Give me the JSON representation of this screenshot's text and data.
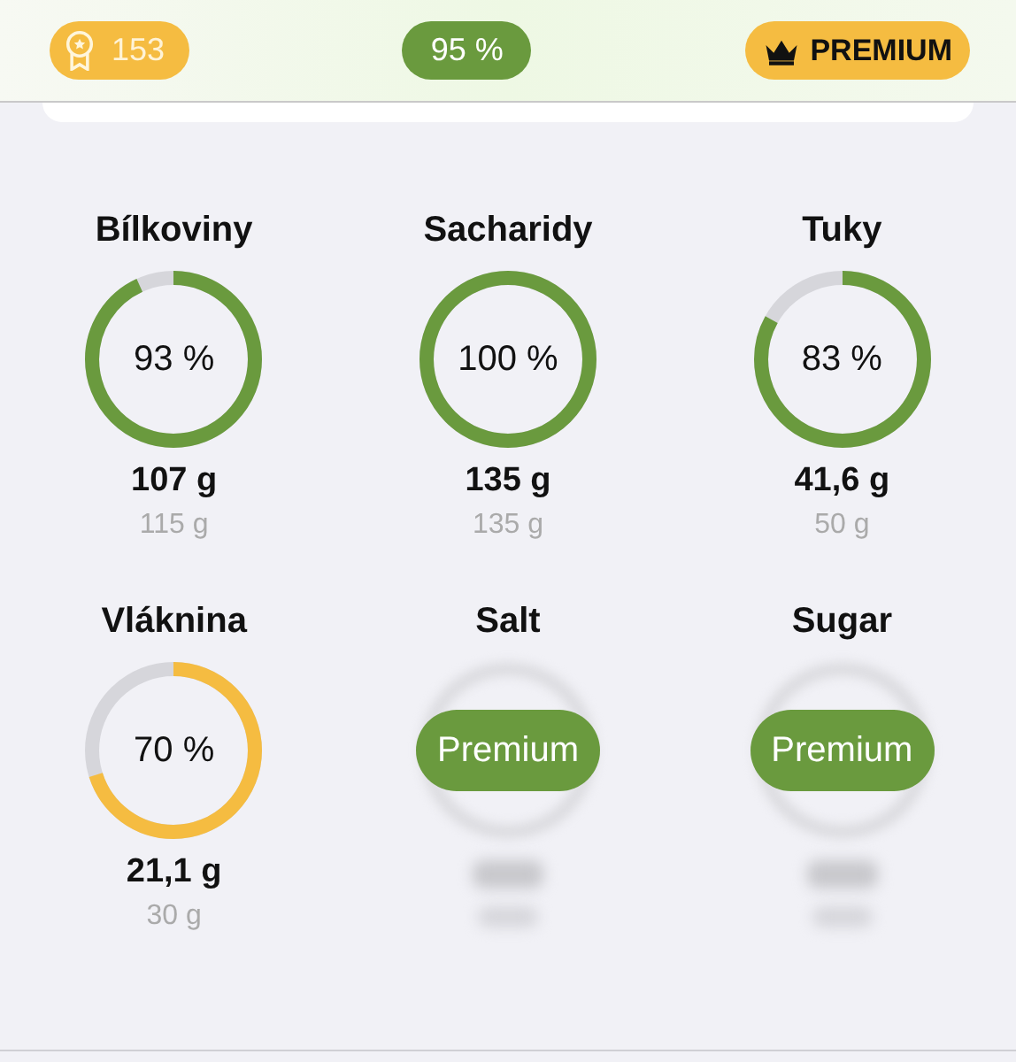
{
  "top_bar": {
    "points": "153",
    "score": "95 %",
    "premium_label": "PREMIUM"
  },
  "nutrients": [
    {
      "kind": "ring",
      "name": "Bílkoviny",
      "percent": "93 %",
      "level": 0.93,
      "color": "#6a9a3e",
      "value": "107 g",
      "target": "115 g"
    },
    {
      "kind": "ring",
      "name": "Sacharidy",
      "percent": "100 %",
      "level": 1,
      "color": "#6a9a3e",
      "value": "135 g",
      "target": "135 g"
    },
    {
      "kind": "ring",
      "name": "Tuky",
      "percent": "83 %",
      "level": 0.83,
      "color": "#6a9a3e",
      "value": "41,6 g",
      "target": "50 g"
    },
    {
      "kind": "ring",
      "name": "Vláknina",
      "percent": "70 %",
      "level": 0.7,
      "color": "#f5bc41",
      "value": "21,1 g",
      "target": "30 g"
    },
    {
      "kind": "locked",
      "name": "Salt",
      "button": "Premium"
    },
    {
      "kind": "locked",
      "name": "Sugar",
      "button": "Premium"
    }
  ]
}
